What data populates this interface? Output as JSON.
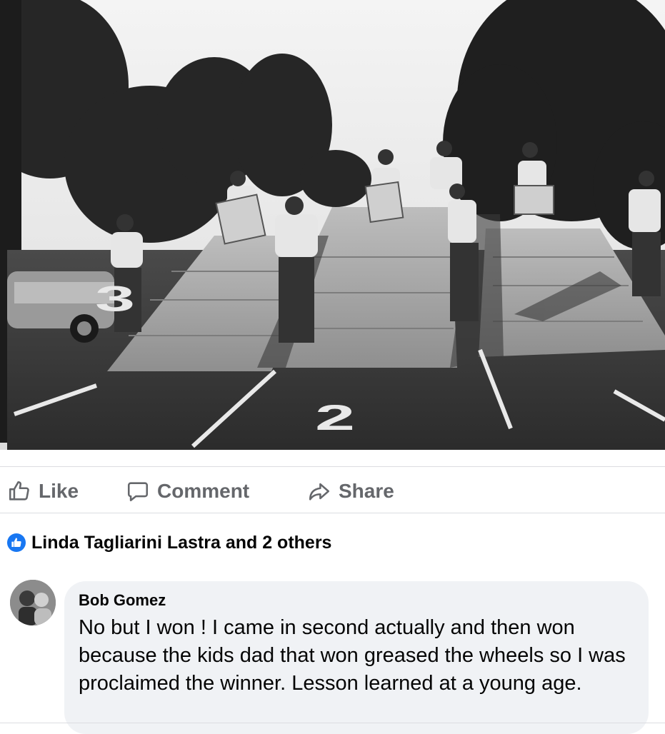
{
  "photo": {
    "description_icon": "black-and-white-photo",
    "lane_numbers": [
      "3",
      "2"
    ]
  },
  "actions": {
    "like_label": "Like",
    "comment_label": "Comment",
    "share_label": "Share",
    "like_icon": "thumbs-up-icon",
    "comment_icon": "speech-bubble-icon",
    "share_icon": "share-arrow-icon"
  },
  "reactions": {
    "summary": "Linda Tagliarini Lastra and 2 others",
    "icon": "like-badge-icon"
  },
  "comment": {
    "author": "Bob Gomez",
    "text": "No but I won !   I came in second actually and then won because the kids dad that won greased the wheels so I was proclaimed the winner.  Lesson learned at a young age."
  },
  "colors": {
    "accent": "#1877f2",
    "secondary_text": "#65676b",
    "bubble": "#f0f2f5"
  }
}
